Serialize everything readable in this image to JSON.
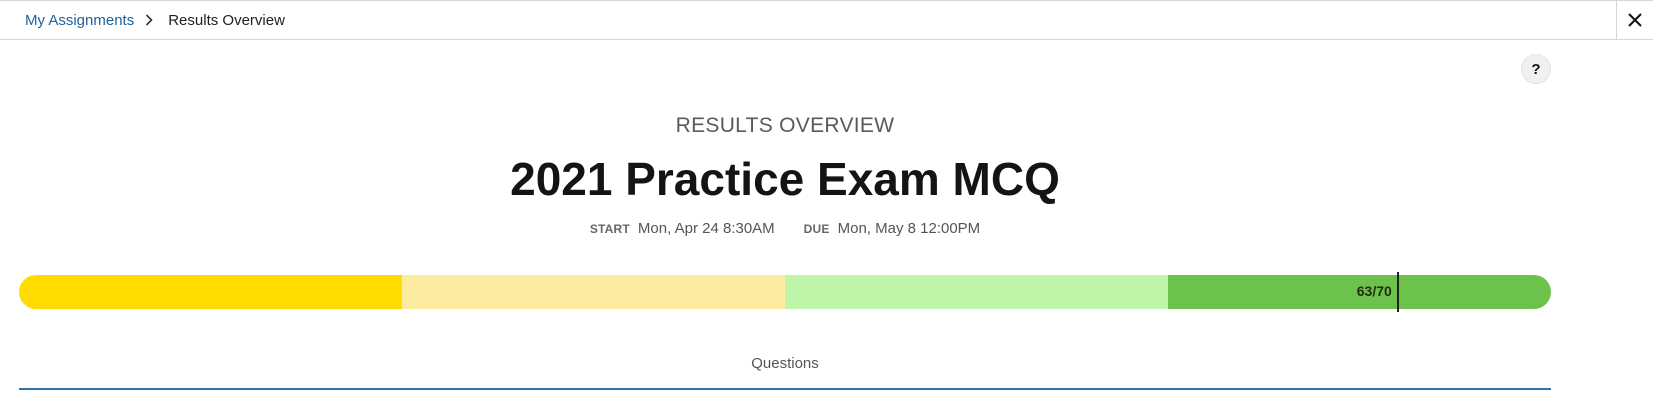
{
  "breadcrumb": {
    "link_label": "My Assignments",
    "current_label": "Results Overview"
  },
  "icons": {
    "breadcrumb_separator": "chevron-right-icon",
    "close": "close-icon",
    "help": "help-icon"
  },
  "help_label": "?",
  "header": {
    "overline": "RESULTS OVERVIEW",
    "title": "2021 Practice Exam MCQ"
  },
  "dates": {
    "start_label": "START",
    "start_value": "Mon, Apr 24 8:30AM",
    "due_label": "DUE",
    "due_value": "Mon, May 8 12:00PM"
  },
  "score": {
    "label": "63/70",
    "earned": 63,
    "total": 70
  },
  "score_bands": [
    {
      "color": "#ffdb00"
    },
    {
      "color": "#fdeca0"
    },
    {
      "color": "#bff5a8"
    },
    {
      "color": "#6cc24a"
    }
  ],
  "colors": {
    "link": "#1f5f9e",
    "accent_line": "#2e75b0"
  },
  "section": {
    "questions_label": "Questions"
  }
}
